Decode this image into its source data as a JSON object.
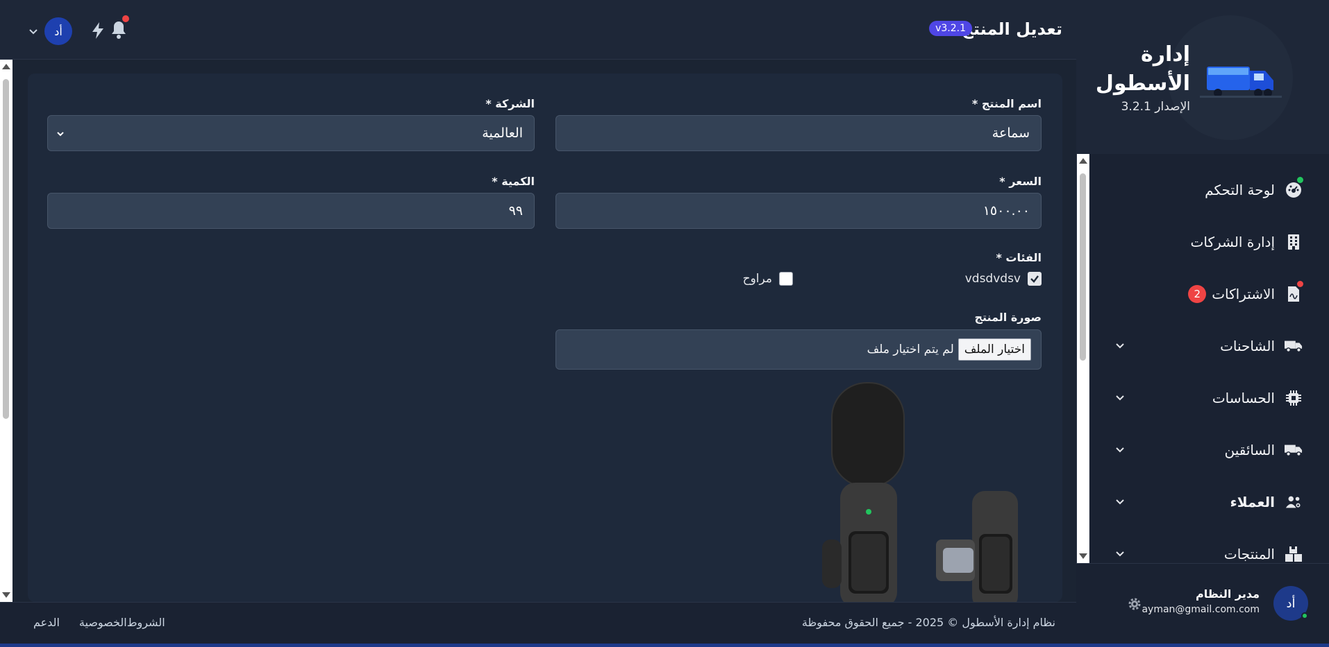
{
  "sidebar": {
    "brand_title_line1": "إدارة",
    "brand_title_line2": "الأسطول",
    "brand_version": "الإصدار 3.2.1",
    "items": [
      {
        "label": "لوحة التحكم",
        "icon": "dashboard-icon",
        "dot_color": "#22c55e"
      },
      {
        "label": "إدارة الشركات",
        "icon": "building-icon"
      },
      {
        "label": "الاشتراكات",
        "icon": "document-icon",
        "badge": "2",
        "dot_color": "#ef4444"
      },
      {
        "label": "الشاحنات",
        "icon": "truck-icon"
      },
      {
        "label": "الحساسات",
        "icon": "chip-icon"
      },
      {
        "label": "السائقين",
        "icon": "truck-icon"
      },
      {
        "label": "العملاء",
        "icon": "users-icon"
      },
      {
        "label": "المنتجات",
        "icon": "boxes-icon"
      }
    ],
    "user": {
      "initials": "أد",
      "name": "مدير النظام",
      "email": "ayman@gmail.com.com"
    }
  },
  "topbar": {
    "title": "تعديل المنتج",
    "version_badge": "v3.2.1",
    "avatar_initials": "أد"
  },
  "form": {
    "product_name_label": "اسم المنتج *",
    "product_name_value": "سماعة",
    "company_label": "الشركة *",
    "company_value": "العالمية",
    "price_label": "السعر *",
    "price_value": "١٥٠٠.٠٠",
    "quantity_label": "الكمية *",
    "quantity_value": "٩٩",
    "categories_label": "الفئات *",
    "categories": [
      {
        "label": "vdsdvdsv",
        "checked": true
      },
      {
        "label": "مراوح",
        "checked": false
      }
    ],
    "image_label": "صورة المنتج",
    "file_button": "اختيار الملف",
    "file_status": "لم يتم اختيار ملف"
  },
  "footer": {
    "copyright": "نظام إدارة الأسطول © 2025 - جميع الحقوق محفوظة",
    "links": [
      "الشروط",
      "الخصوصية",
      "الدعم"
    ]
  },
  "colors": {
    "accent": "#4f46e5",
    "background": "#1b2433",
    "card": "#1e293b",
    "danger": "#ef4444",
    "online": "#22c55e"
  }
}
